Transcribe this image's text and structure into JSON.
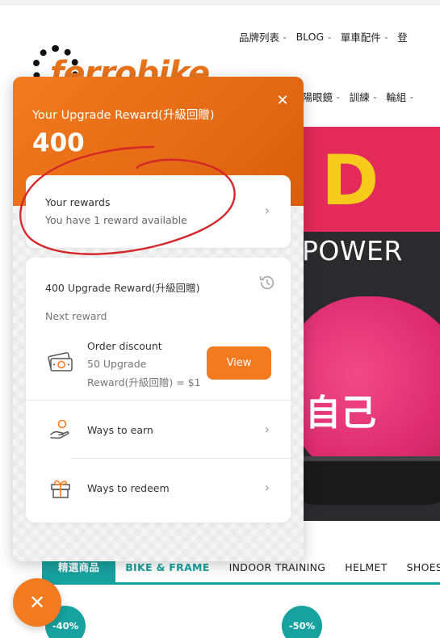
{
  "site": {
    "logo_text": "ferrobike",
    "nav_row_1": [
      {
        "label": "品牌列表"
      },
      {
        "label": "BLOG"
      },
      {
        "label": "單車配件"
      },
      {
        "label": "登"
      }
    ],
    "nav_row_2": [
      {
        "label": "太陽眼鏡"
      },
      {
        "label": "訓練"
      },
      {
        "label": "輪組"
      }
    ]
  },
  "hero": {
    "letter": "D",
    "headline": "POWER",
    "cjk_text": "自己"
  },
  "category_tabs": [
    {
      "label": "精選商品",
      "state": "active"
    },
    {
      "label": "BIKE & FRAME",
      "state": "accent"
    },
    {
      "label": "INDOOR TRAINING",
      "state": "normal"
    },
    {
      "label": "HELMET",
      "state": "normal"
    },
    {
      "label": "SHOES",
      "state": "normal"
    }
  ],
  "discount_badges": [
    "-40%",
    "-50%"
  ],
  "widget": {
    "title": "Your Upgrade Reward(升級回贈)",
    "points": "400",
    "close_icon": "close-icon",
    "rewards_card": {
      "title": "Your rewards",
      "subtitle": "You have 1 reward available"
    },
    "balance_card": {
      "title": "400 Upgrade Reward(升級回贈)",
      "history_icon": "history-icon",
      "next_reward_label": "Next reward",
      "reward_name": "Order discount",
      "reward_cost_line1": "50 Upgrade",
      "reward_cost_line2": "Reward(升級回贈) = $1",
      "view_label": "View"
    },
    "ways": [
      {
        "label": "Ways to earn",
        "icon": "hand-coin-icon"
      },
      {
        "label": "Ways to redeem",
        "icon": "gift-icon"
      }
    ]
  },
  "launcher": {
    "icon": "close-icon",
    "glyph": "✕"
  },
  "colors": {
    "accent_orange": "#f47a1f",
    "teal": "#17a2a0",
    "annotation_red": "#d7262a"
  }
}
